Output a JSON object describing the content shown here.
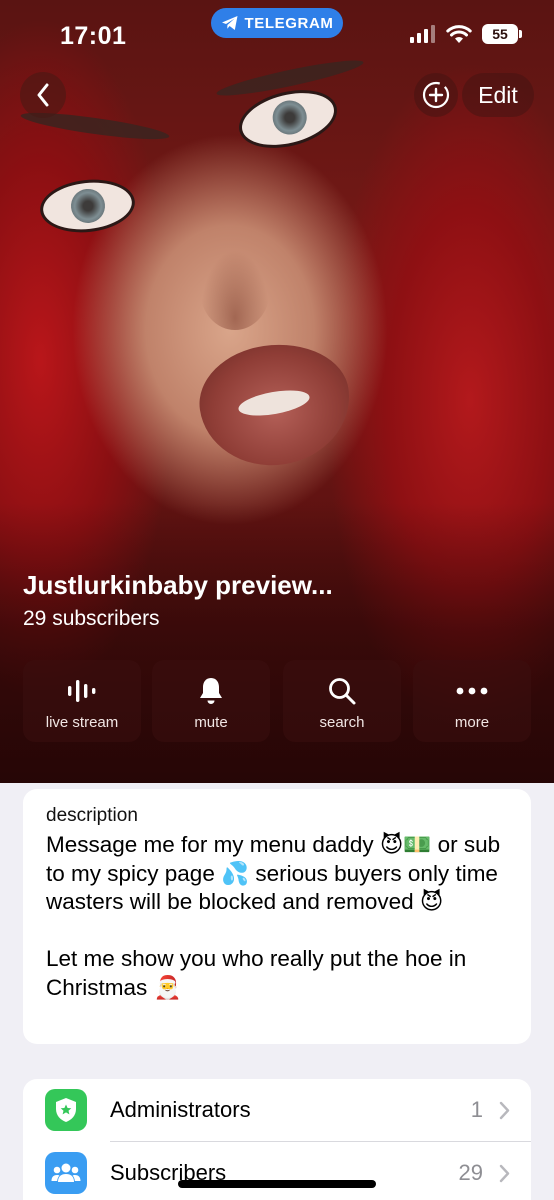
{
  "status_bar": {
    "time": "17:01",
    "app_pill": "TELEGRAM",
    "battery": "55",
    "icons": [
      "signal-icon",
      "wifi-icon",
      "battery-icon"
    ]
  },
  "nav": {
    "back_icon": "chevron-left-icon",
    "add_icon": "add-circle-icon",
    "edit_label": "Edit"
  },
  "channel": {
    "title": "Justlurkinbaby preview...",
    "subtitle": "29 subscribers"
  },
  "actions": [
    {
      "label": "live stream",
      "icon": "live-stream-icon"
    },
    {
      "label": "mute",
      "icon": "bell-icon"
    },
    {
      "label": "search",
      "icon": "search-icon"
    },
    {
      "label": "more",
      "icon": "more-icon"
    }
  ],
  "description": {
    "heading": "description",
    "text": "Message me for my menu daddy 😈💵 or sub to my spicy page 💦 serious buyers only time wasters will be blocked and removed 😈\n\nLet me show you who really put the hoe in Christmas 🎅"
  },
  "list": [
    {
      "label": "Administrators",
      "count": "1",
      "icon": "shield-star-icon",
      "color": "#34c759"
    },
    {
      "label": "Subscribers",
      "count": "29",
      "icon": "people-icon",
      "color": "#3a9df2"
    }
  ],
  "colors": {
    "telegram_blue": "#2f7fe8",
    "background": "#f0eff5",
    "admin_green": "#34c759",
    "subscribers_blue": "#3a9df2"
  }
}
